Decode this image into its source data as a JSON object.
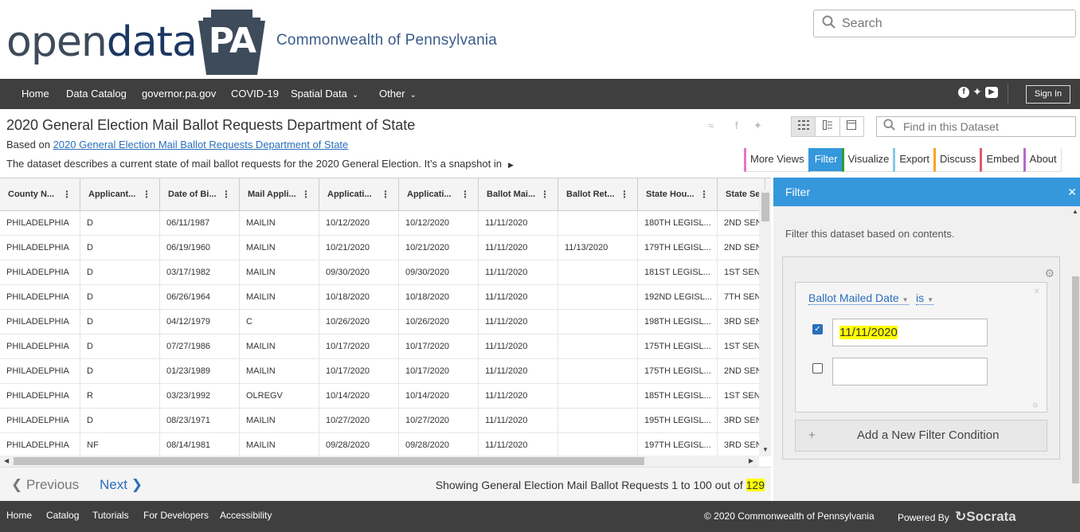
{
  "header": {
    "logo_open": "open",
    "logo_data": "data",
    "logo_pa": "PA",
    "subtitle": "Commonwealth of Pennsylvania",
    "search_placeholder": "Search"
  },
  "nav": {
    "items": [
      "Home",
      "Data Catalog",
      "governor.pa.gov",
      "COVID-19",
      "Spatial Data",
      "Other"
    ],
    "sign_in": "Sign In"
  },
  "dataset": {
    "title": "2020 General Election Mail Ballot Requests Department of State",
    "based_on_prefix": "Based on",
    "based_on_link": "2020 General Election Mail Ballot Requests Department of State",
    "description": "The dataset describes a current state of mail ballot requests for the 2020 General Election. It’s a snapshot in",
    "find_placeholder": "Find in this Dataset",
    "tabs": [
      "More Views",
      "Filter",
      "Visualize",
      "Export",
      "Discuss",
      "Embed",
      "About"
    ]
  },
  "grid": {
    "columns": [
      "County N...",
      "Applicant...",
      "Date of Bi...",
      "Mail Appli...",
      "Applicati...",
      "Applicati...",
      "Ballot Mai...",
      "Ballot Ret...",
      "State Hou...",
      "State Se..."
    ],
    "rows": [
      [
        "PHILADELPHIA",
        "D",
        "06/11/1987",
        "MAILIN",
        "10/12/2020",
        "10/12/2020",
        "11/11/2020",
        "",
        "180TH LEGISL...",
        "2ND SEN"
      ],
      [
        "PHILADELPHIA",
        "D",
        "06/19/1960",
        "MAILIN",
        "10/21/2020",
        "10/21/2020",
        "11/11/2020",
        "11/13/2020",
        "179TH LEGISL...",
        "2ND SEN"
      ],
      [
        "PHILADELPHIA",
        "D",
        "03/17/1982",
        "MAILIN",
        "09/30/2020",
        "09/30/2020",
        "11/11/2020",
        "",
        "181ST LEGISL...",
        "1ST SEN."
      ],
      [
        "PHILADELPHIA",
        "D",
        "06/26/1964",
        "MAILIN",
        "10/18/2020",
        "10/18/2020",
        "11/11/2020",
        "",
        "192ND LEGISL...",
        "7TH SEN"
      ],
      [
        "PHILADELPHIA",
        "D",
        "04/12/1979",
        "C",
        "10/26/2020",
        "10/26/2020",
        "11/11/2020",
        "",
        "198TH LEGISL...",
        "3RD SEN"
      ],
      [
        "PHILADELPHIA",
        "D",
        "07/27/1986",
        "MAILIN",
        "10/17/2020",
        "10/17/2020",
        "11/11/2020",
        "",
        "175TH LEGISL...",
        "1ST SEN."
      ],
      [
        "PHILADELPHIA",
        "D",
        "01/23/1989",
        "MAILIN",
        "10/17/2020",
        "10/17/2020",
        "11/11/2020",
        "",
        "175TH LEGISL...",
        "2ND SEN"
      ],
      [
        "PHILADELPHIA",
        "R",
        "03/23/1992",
        "OLREGV",
        "10/14/2020",
        "10/14/2020",
        "11/11/2020",
        "",
        "185TH LEGISL...",
        "1ST SEN."
      ],
      [
        "PHILADELPHIA",
        "D",
        "08/23/1971",
        "MAILIN",
        "10/27/2020",
        "10/27/2020",
        "11/11/2020",
        "",
        "195TH LEGISL...",
        "3RD SEN"
      ],
      [
        "PHILADELPHIA",
        "NF",
        "08/14/1981",
        "MAILIN",
        "09/28/2020",
        "09/28/2020",
        "11/11/2020",
        "",
        "197TH LEGISL...",
        "3RD SEN"
      ]
    ]
  },
  "pager": {
    "previous": "Previous",
    "next": "Next",
    "showing_prefix": "Showing General Election Mail Ballot Requests 1 to 100 out of",
    "total": "129"
  },
  "filter_pane": {
    "title": "Filter",
    "description": "Filter this dataset based on contents.",
    "column": "Ballot Mailed Date",
    "operator": "is",
    "value1": "11/11/2020",
    "value2": "",
    "add_condition": "Add a New Filter Condition"
  },
  "footer": {
    "links": [
      "Home",
      "Catalog",
      "Tutorials",
      "For Developers",
      "Accessibility"
    ],
    "copyright": "© 2020 Commonwealth of Pennsylvania",
    "powered_by": "Powered By",
    "brand": "Socrata"
  },
  "colors": {
    "accent": "#3597dc",
    "nav_bg": "#3f3f3f",
    "link": "#2a6ebb",
    "highlight": "#ffff00",
    "tab_borders": [
      "#e377c2",
      "#3597dc",
      "#2ca02c",
      "#86c8e8",
      "#f5a623",
      "#e05a6a",
      "#bb66cc"
    ]
  }
}
